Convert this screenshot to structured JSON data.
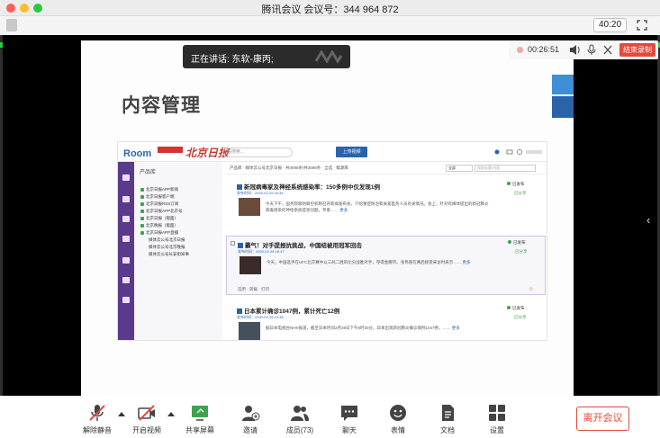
{
  "window": {
    "title": "腾讯会议 会议号：344 964 872",
    "timer": "40:20"
  },
  "speaking": {
    "text": "正在讲话: 东软-康丙;"
  },
  "recording": {
    "time": "00:26:51",
    "stop_label": "结束录制"
  },
  "slide": {
    "title": "内容管理"
  },
  "cms": {
    "logo_room": "Room",
    "logo_name": "北京日报",
    "search_placeholder": "请搜索...",
    "upload_label": "上传视频",
    "tree_header": "产品库",
    "tree_items": [
      "北京日报APP新闻",
      "北京日报客户端",
      "北京日报RSS订阅",
      "北京日报APP北京号",
      "北京日报（版面）",
      "北京晚报（版面）",
      "北京日报APP直播",
      "媒体云公号北京日报",
      "媒体云公号北京晚报",
      "媒体云公号长安街知事"
    ],
    "filter_text": "产品库 · 媒体云公号北京日报 · 共3698条/共3698条 · 全选 · 稿源库",
    "filter_select": "全部",
    "filter_search": "搜索标题/内容",
    "cards": [
      {
        "title": "新冠病毒家及神经系统感染率：150多例中仅发现1例",
        "meta": "发布时间：2020-02-29 16:34",
        "body": "今天下午，国务院联防联控机制召开新闻发布会，介绍重症防治和关爱医务人员有关情况。会上，针对有媒体提出的新冠肺炎病毒感染的神经系统症状问题，专家……",
        "more": "更多",
        "badge": "已发布",
        "share": "已分享"
      },
      {
        "title": "霸气！对手提报抗挑战，中国结被用冠军回击",
        "meta": "发布时间：2020-02-28 18:47",
        "body": "今天，中国选手在UFC北京赛中以三局二胜的比分战胜对手，夺得金腰带。张伟丽在赛后接受采访时表示……",
        "more": "更多",
        "badge": "已发布",
        "share": "已分享",
        "actions": "选用 · 转载 · 打印"
      },
      {
        "title": "日本累计确诊1047例，累计死亡12例",
        "meta": "发布时间：2020-02-28 19:38",
        "body": "据日本电视台NHK报道，截至日本时间2月28日下午6时30分，日本出现新冠肺炎确诊病例1047例，……",
        "more": "更多",
        "badge": "已发布",
        "share": "已分享"
      }
    ]
  },
  "controls": [
    {
      "label": "解除静音",
      "icon": "mic-muted-icon"
    },
    {
      "label": "开启视频",
      "icon": "video-off-icon"
    },
    {
      "label": "共享屏幕",
      "icon": "screen-share-icon"
    },
    {
      "label": "邀请",
      "icon": "invite-icon"
    },
    {
      "label": "成员(73)",
      "icon": "members-icon"
    },
    {
      "label": "聊天",
      "icon": "chat-icon"
    },
    {
      "label": "表情",
      "icon": "emoji-icon"
    },
    {
      "label": "文档",
      "icon": "document-icon"
    },
    {
      "label": "设置",
      "icon": "settings-icon"
    }
  ],
  "leave_label": "离开会议",
  "colors": {
    "accent": "#2a64a8",
    "danger": "#e04b3c",
    "sidebar": "#5b3a8c",
    "green": "#2ecc40"
  }
}
